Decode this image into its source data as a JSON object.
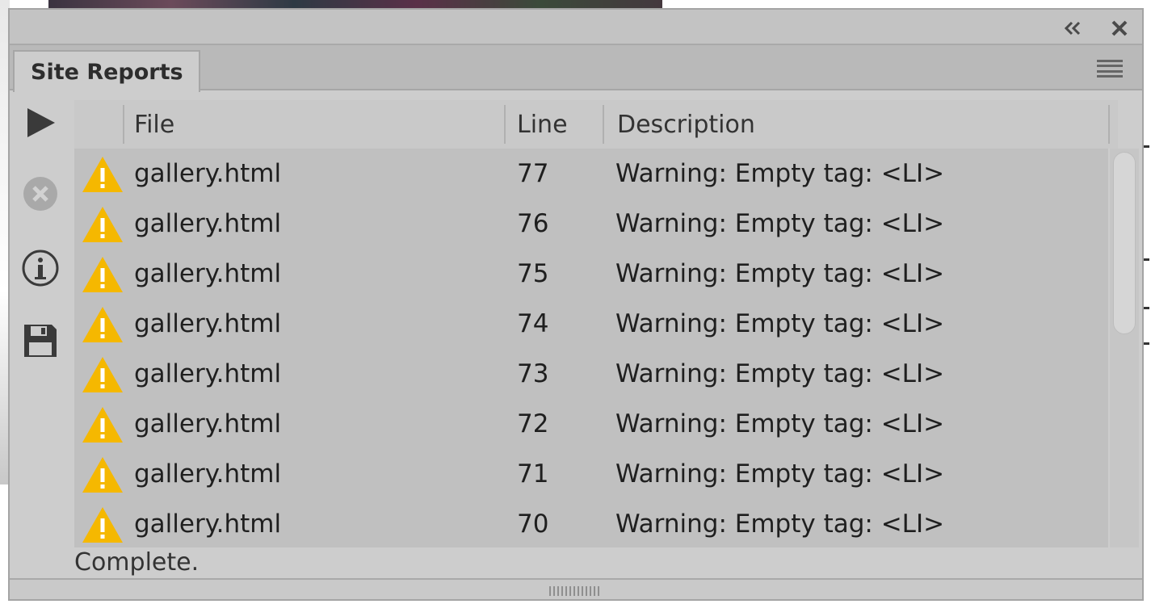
{
  "panel": {
    "tab_label": "Site Reports",
    "collapse_icon": "double-chevron-left-icon",
    "close_icon": "close-icon",
    "menu_icon": "hamburger-menu-icon"
  },
  "toolbar": {
    "run_icon": "play-icon",
    "stop_icon": "stop-circle-icon",
    "info_icon": "info-icon",
    "save_icon": "save-disk-icon"
  },
  "columns": {
    "file": "File",
    "line": "Line",
    "description": "Description"
  },
  "rows": [
    {
      "file": "gallery.html",
      "line": "77",
      "description": "Warning: Empty tag: <LI>"
    },
    {
      "file": "gallery.html",
      "line": "76",
      "description": "Warning: Empty tag: <LI>"
    },
    {
      "file": "gallery.html",
      "line": "75",
      "description": "Warning: Empty tag: <LI>"
    },
    {
      "file": "gallery.html",
      "line": "74",
      "description": "Warning: Empty tag: <LI>"
    },
    {
      "file": "gallery.html",
      "line": "73",
      "description": "Warning: Empty tag: <LI>"
    },
    {
      "file": "gallery.html",
      "line": "72",
      "description": "Warning: Empty tag: <LI>"
    },
    {
      "file": "gallery.html",
      "line": "71",
      "description": "Warning: Empty tag: <LI>"
    },
    {
      "file": "gallery.html",
      "line": "70",
      "description": "Warning: Empty tag: <LI>"
    }
  ],
  "status": "Complete.",
  "colors": {
    "warning_fill": "#f5b800",
    "panel_bg": "#cdcdcd",
    "grid_bg": "#c0c0c0"
  }
}
